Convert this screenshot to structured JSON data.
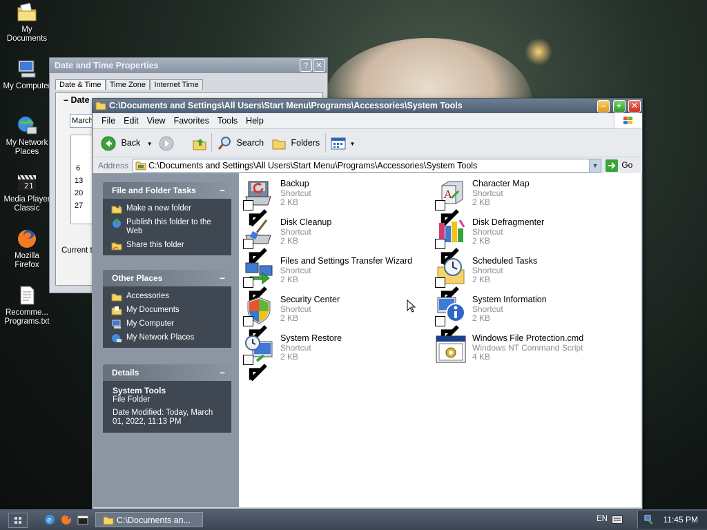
{
  "desktop": {
    "icons": [
      {
        "label": "My Documents",
        "icon": "my-documents-icon"
      },
      {
        "label": "My Computer",
        "icon": "my-computer-icon"
      },
      {
        "label": "My Network Places",
        "icon": "network-places-icon"
      },
      {
        "label": "Media Player Classic",
        "icon": "media-player-icon"
      },
      {
        "label": "Mozilla Firefox",
        "icon": "firefox-icon"
      },
      {
        "label": "Recomme... Programs.txt",
        "icon": "text-file-icon"
      }
    ]
  },
  "datetime_window": {
    "title": "Date and Time Properties",
    "tabs": [
      "Date & Time",
      "Time Zone",
      "Internet Time"
    ],
    "group_label": "Date",
    "month_value": "March",
    "calendar_days": [
      "6",
      "13",
      "20",
      "27"
    ],
    "current_label": "Current t"
  },
  "explorer": {
    "title": "C:\\Documents and Settings\\All Users\\Start Menu\\Programs\\Accessories\\System Tools",
    "menu": [
      "File",
      "Edit",
      "View",
      "Favorites",
      "Tools",
      "Help"
    ],
    "toolbar": {
      "back": "Back",
      "search": "Search",
      "folders": "Folders"
    },
    "address": {
      "label": "Address",
      "value": "C:\\Documents and Settings\\All Users\\Start Menu\\Programs\\Accessories\\System Tools",
      "go": "Go"
    },
    "tasks_panel": {
      "title": "File and Folder Tasks",
      "items": [
        "Make a new folder",
        "Publish this folder to the Web",
        "Share this folder"
      ]
    },
    "places_panel": {
      "title": "Other Places",
      "items": [
        "Accessories",
        "My Documents",
        "My Computer",
        "My Network Places"
      ]
    },
    "details_panel": {
      "title": "Details",
      "name": "System Tools",
      "type": "File Folder",
      "modified": "Date Modified: Today, March 01, 2022, 11:13 PM"
    },
    "files": [
      {
        "name": "Backup",
        "type": "Shortcut",
        "size": "2 KB",
        "icon": "backup-icon"
      },
      {
        "name": "Character Map",
        "type": "Shortcut",
        "size": "2 KB",
        "icon": "character-map-icon"
      },
      {
        "name": "Disk Cleanup",
        "type": "Shortcut",
        "size": "2 KB",
        "icon": "disk-cleanup-icon"
      },
      {
        "name": "Disk Defragmenter",
        "type": "Shortcut",
        "size": "2 KB",
        "icon": "defragmenter-icon"
      },
      {
        "name": "Files and Settings Transfer Wizard",
        "type": "Shortcut",
        "size": "2 KB",
        "icon": "transfer-wizard-icon"
      },
      {
        "name": "Scheduled Tasks",
        "type": "Shortcut",
        "size": "2 KB",
        "icon": "scheduled-tasks-icon"
      },
      {
        "name": "Security Center",
        "type": "Shortcut",
        "size": "2 KB",
        "icon": "security-center-icon"
      },
      {
        "name": "System Information",
        "type": "Shortcut",
        "size": "2 KB",
        "icon": "system-information-icon"
      },
      {
        "name": "System Restore",
        "type": "Shortcut",
        "size": "2 KB",
        "icon": "system-restore-icon"
      },
      {
        "name": "Windows File Protection.cmd",
        "type": "Windows NT Command Script",
        "size": "4 KB",
        "icon": "cmd-script-icon"
      }
    ]
  },
  "taskbar": {
    "task_label": "C:\\Documents an...",
    "language": "EN",
    "clock": "11:45 PM"
  }
}
